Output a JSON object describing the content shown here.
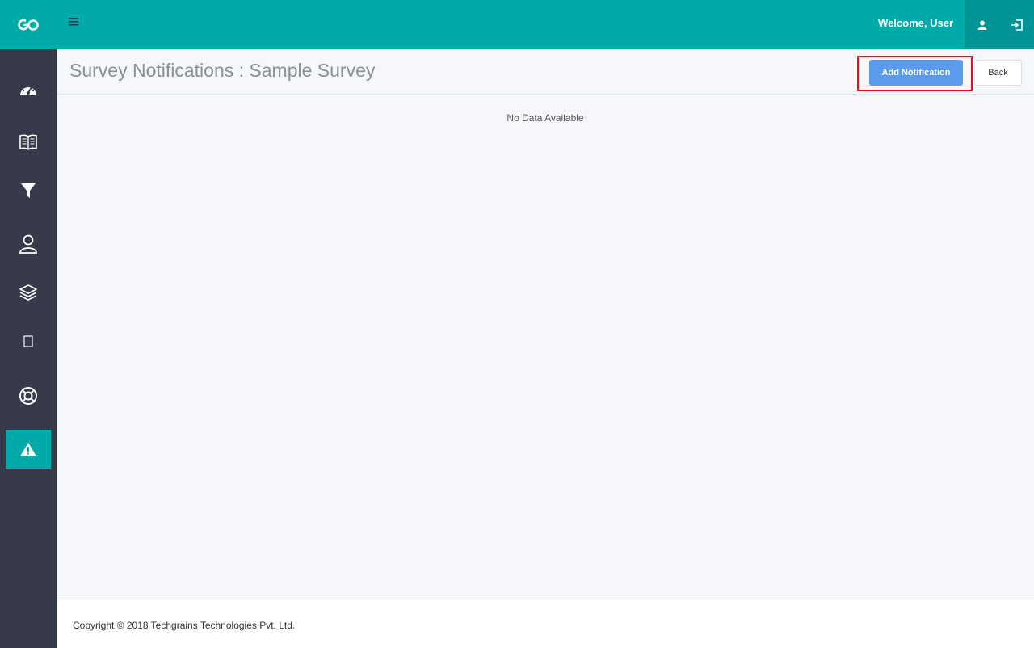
{
  "header": {
    "logo_text": "GO",
    "welcome": "Welcome, User",
    "menu_icon": "hamburger-icon",
    "user_icon": "user-icon",
    "logout_icon": "logout-icon"
  },
  "sidebar": {
    "items": [
      {
        "icon": "dashboard-icon",
        "active": false
      },
      {
        "icon": "book-icon",
        "active": false
      },
      {
        "icon": "filter-icon",
        "active": false
      },
      {
        "icon": "user-outline-icon",
        "active": false
      },
      {
        "icon": "layers-icon",
        "active": false
      },
      {
        "icon": "mobile-icon",
        "active": false
      },
      {
        "icon": "lifebuoy-icon",
        "active": false
      },
      {
        "icon": "warning-icon",
        "active": true
      }
    ]
  },
  "page": {
    "title": "Survey Notifications : Sample Survey",
    "add_button": "Add Notification",
    "back_button": "Back",
    "empty_message": "No Data Available"
  },
  "footer": {
    "copyright": "Copyright © 2018 Techgrains Technologies Pvt. Ltd."
  },
  "colors": {
    "primary": "#00aaa9",
    "sidebar": "#373a4a",
    "button": "#5b9bec",
    "highlight": "#e0111a"
  }
}
